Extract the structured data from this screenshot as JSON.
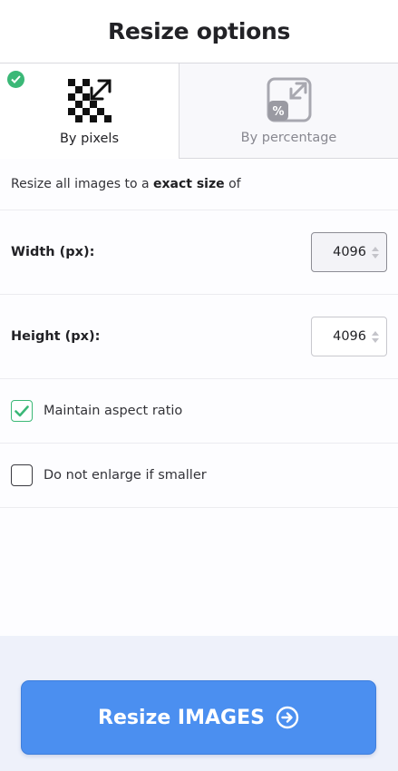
{
  "header": {
    "title": "Resize options"
  },
  "tabs": [
    {
      "label": "By pixels",
      "icon": "pixels-resize-icon",
      "active": true
    },
    {
      "label": "By percentage",
      "icon": "percentage-resize-icon",
      "active": false
    }
  ],
  "intro": {
    "prefix": "Resize all images to a",
    "emphasis": "exact size",
    "suffix": "of"
  },
  "fields": {
    "width": {
      "label": "Width (px):",
      "value": "4096"
    },
    "height": {
      "label": "Height (px):",
      "value": "4096"
    }
  },
  "options": {
    "maintain_aspect": {
      "label": "Maintain aspect ratio",
      "checked": true
    },
    "no_enlarge": {
      "label": "Do not enlarge if smaller",
      "checked": false
    }
  },
  "action": {
    "label": "Resize IMAGES",
    "icon": "arrow-circle-right-icon"
  },
  "colors": {
    "accent": "#4b8ff0",
    "success": "#3bb877",
    "muted": "#888890"
  }
}
